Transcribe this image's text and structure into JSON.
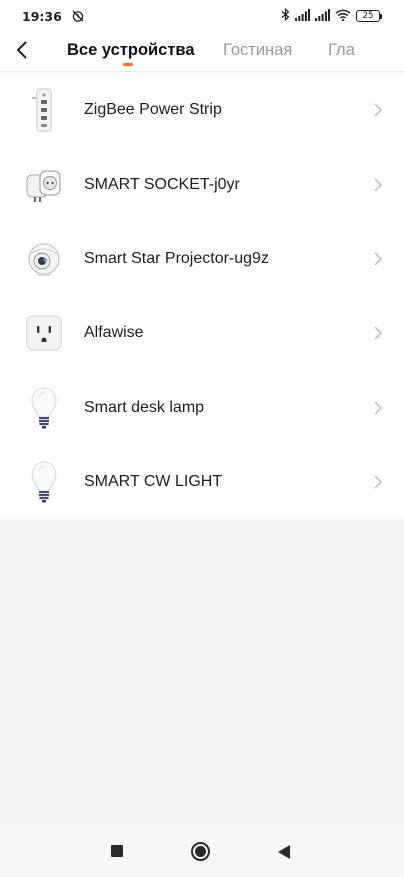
{
  "status_bar": {
    "time": "19:36",
    "battery_level": "25",
    "icons": [
      "alarm-off-icon",
      "bluetooth-icon",
      "signal-icon",
      "signal-icon",
      "wifi-icon",
      "battery-icon"
    ]
  },
  "header": {
    "back_icon": "chevron-left-icon",
    "tabs": [
      {
        "label": "Все устройства",
        "active": true
      },
      {
        "label": "Гостиная",
        "active": false
      },
      {
        "label": "Гла",
        "active": false
      }
    ],
    "accent_color": "#ff6a1a"
  },
  "devices": [
    {
      "name": "ZigBee Power Strip",
      "icon": "power-strip-icon"
    },
    {
      "name": "SMART SOCKET-j0yr",
      "icon": "smart-socket-icon"
    },
    {
      "name": "Smart Star Projector-ug9z",
      "icon": "projector-icon"
    },
    {
      "name": "Alfawise",
      "icon": "wall-outlet-icon"
    },
    {
      "name": "Smart desk lamp",
      "icon": "light-bulb-icon"
    },
    {
      "name": "SMART CW LIGHT",
      "icon": "light-bulb-icon"
    }
  ],
  "nav_bar": {
    "icons": [
      "recent-apps-icon",
      "home-icon",
      "back-icon"
    ]
  }
}
